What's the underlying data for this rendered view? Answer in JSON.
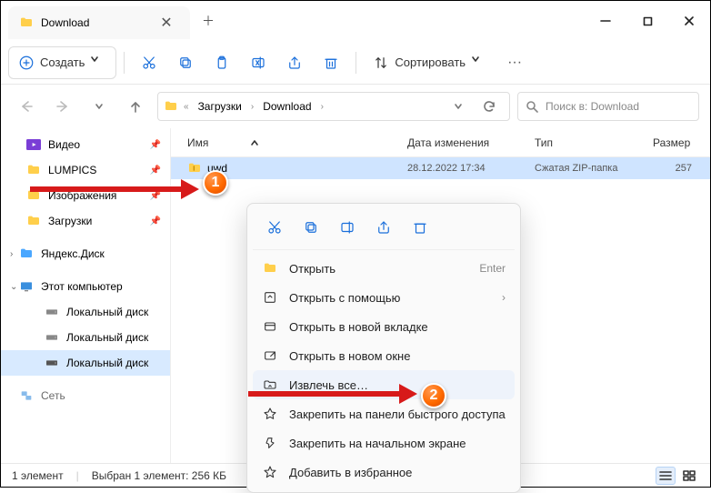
{
  "window": {
    "title": "Download",
    "minimize": "—",
    "maximize": "▢",
    "close": "✕"
  },
  "toolbar": {
    "create": "Создать",
    "sort": "Сортировать"
  },
  "breadcrumb": {
    "parts": [
      "Загрузки",
      "Download"
    ]
  },
  "search": {
    "placeholder": "Поиск в: Download"
  },
  "columns": {
    "name": "Имя",
    "date": "Дата изменения",
    "type": "Тип",
    "size": "Размер"
  },
  "sidebar": {
    "items": [
      {
        "label": "Видео",
        "pinned": true,
        "icon": "video",
        "color": "#7a3ed6"
      },
      {
        "label": "LUMPICS",
        "pinned": true,
        "icon": "folder",
        "color": "#ffcf4b"
      },
      {
        "label": "Изображения",
        "pinned": true,
        "icon": "folder",
        "color": "#ffcf4b"
      },
      {
        "label": "Загрузки",
        "pinned": true,
        "icon": "folder",
        "color": "#ffcf4b"
      }
    ],
    "yandex": "Яндекс.Диск",
    "thispc": "Этот компьютер",
    "drives": [
      "Локальный диск",
      "Локальный диск",
      "Локальный диск"
    ],
    "network": "Сеть"
  },
  "rows": [
    {
      "name": "uwd",
      "date": "28.12.2022 17:34",
      "type": "Сжатая ZIP-папка",
      "size": "257"
    }
  ],
  "context": {
    "open": "Открыть",
    "enter": "Enter",
    "openwith": "Открыть с помощью",
    "newtab": "Открыть в новой вкладке",
    "newwin": "Открыть в новом окне",
    "extract": "Извлечь все…",
    "pinqa": "Закрепить на панели быстрого доступа",
    "pinstart": "Закрепить на начальном экране",
    "fav": "Добавить в избранное"
  },
  "status": {
    "count": "1 элемент",
    "selection": "Выбран 1 элемент: 256 КБ"
  },
  "annotations": {
    "one": "1",
    "two": "2"
  }
}
